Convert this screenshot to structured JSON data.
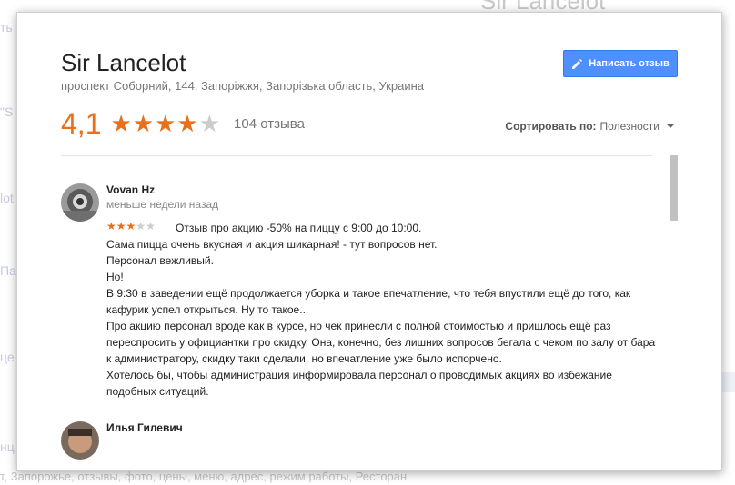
{
  "background": {
    "right_title": "Sir Lancelot",
    "bottom_text": "т, Запорожье, отзывы, фото, цены, меню, адрес, режим работы, Ресторан"
  },
  "dialog": {
    "title": "Sir Lancelot",
    "address": "проспект Соборний, 144, Запоріжжя, Запорізька область, Украина",
    "write_button_label": "Написать отзыв",
    "rating": "4,1",
    "rating_value": 4.1,
    "stars_filled": 4,
    "stars_total": 5,
    "review_count": "104 отзыва",
    "sort_label": "Сортировать по:",
    "sort_value": "Полезности"
  },
  "reviews": [
    {
      "name": "Vovan Hz",
      "time": "меньше недели назад",
      "stars": 3,
      "lines": [
        "Отзыв про акцию -50% на пиццу с 9:00 до 10:00.",
        "Сама пицца очень вкусная и акция шикарная! - тут вопросов нет.",
        "Персонал вежливый.",
        "Но!",
        "В 9:30 в заведении ещё продолжается уборка и такое впечатление, что тебя впустили ещё до того, как кафурик успел открыться. Ну то такое...",
        "Про акцию персонал вроде как в курсе, но чек принесли с полной стоимостью и пришлось ещё раз переспросить у официантки про скидку. Она, конечно, без лишних вопросов бегала с чеком по залу от бара к администратору, скидку таки сделали, но впечатление уже было испорчено.",
        "Хотелось бы, чтобы администрация информировала персонал о проводимых акциях во избежание подобных ситуаций."
      ]
    },
    {
      "name": "Илья Гилевич"
    }
  ],
  "colors": {
    "accent_orange": "#e7711b",
    "button_blue": "#4d90fe"
  }
}
